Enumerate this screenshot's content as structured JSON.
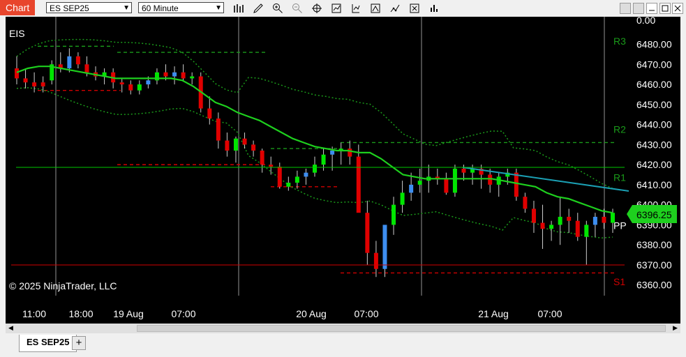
{
  "app": {
    "title": "Chart"
  },
  "toolbar": {
    "instrument": "ES SEP25",
    "interval": "60 Minute",
    "icons": [
      "bar-type-icon",
      "draw-icon",
      "zoom-in-icon",
      "zoom-out-icon",
      "crosshair-icon",
      "indicators-icon",
      "strategies-icon",
      "trade-icon",
      "templates-icon",
      "properties-icon"
    ]
  },
  "chart": {
    "label": "EIS",
    "copyright": "© 2025 NinjaTrader, LLC",
    "price_badge": "6396.25",
    "top_partial": "0.00",
    "colors": {
      "up": "#00e600",
      "down": "#e00000",
      "up_blue": "#3d8ef0",
      "down_red": "#e00000",
      "ma": "#1ed01e",
      "trend": "#1ba0b4"
    }
  },
  "tabs": {
    "active": "ES SEP25",
    "add": "+"
  },
  "chart_data": {
    "type": "candlestick",
    "y_range": [
      6354,
      6484
    ],
    "y_ticks": [
      "6480.00",
      "6470.00",
      "6460.00",
      "6450.00",
      "6440.00",
      "6430.00",
      "6420.00",
      "6410.00",
      "6400.00",
      "6390.00",
      "6380.00",
      "6370.00",
      "6360.00"
    ],
    "x_labels": [
      "11:00",
      "18:00",
      "19 Aug",
      "07:00",
      "20 Aug",
      "07:00",
      "21 Aug",
      "07:00"
    ],
    "pivots": [
      {
        "name": "R3",
        "value": 6482
      },
      {
        "name": "R2",
        "value": 6438
      },
      {
        "name": "R1",
        "value": 6414
      },
      {
        "name": "PP",
        "value": 6390
      },
      {
        "name": "S1",
        "value": 6362
      }
    ],
    "last_price": 6396.25,
    "ma": [
      6466,
      6468,
      6469,
      6469,
      6468,
      6467,
      6466,
      6465,
      6464,
      6463,
      6463,
      6463,
      6463,
      6463,
      6463,
      6462,
      6459,
      6455,
      6451,
      6449,
      6446,
      6444,
      6442,
      6439,
      6436,
      6433,
      6431,
      6429,
      6428,
      6427,
      6427,
      6426,
      6426,
      6423,
      6419,
      6415,
      6414,
      6413,
      6413,
      6413,
      6413,
      6413,
      6413,
      6413,
      6412,
      6411,
      6410,
      6409,
      6406,
      6404,
      6403,
      6401,
      6399,
      6397,
      6396
    ],
    "candles": [
      [
        6468,
        6474,
        6460,
        6463
      ],
      [
        6463,
        6468,
        6458,
        6461
      ],
      [
        6461,
        6466,
        6456,
        6459
      ],
      [
        6461,
        6464,
        6456,
        6459
      ],
      [
        6462,
        6472,
        6460,
        6470
      ],
      [
        6470,
        6476,
        6466,
        6468
      ],
      [
        6468,
        6478,
        6466,
        6474
      ],
      [
        6474,
        6476,
        6468,
        6470
      ],
      [
        6470,
        6474,
        6464,
        6466
      ],
      [
        6466,
        6469,
        6462,
        6464
      ],
      [
        6464,
        6468,
        6460,
        6466
      ],
      [
        6466,
        6468,
        6458,
        6461
      ],
      [
        6461,
        6463,
        6456,
        6460
      ],
      [
        6460,
        6462,
        6455,
        6457
      ],
      [
        6457,
        6462,
        6455,
        6460
      ],
      [
        6460,
        6464,
        6458,
        6462
      ],
      [
        6462,
        6468,
        6460,
        6466
      ],
      [
        6466,
        6470,
        6462,
        6464
      ],
      [
        6464,
        6469,
        6460,
        6466
      ],
      [
        6466,
        6470,
        6462,
        6463
      ],
      [
        6463,
        6466,
        6460,
        6464
      ],
      [
        6464,
        6466,
        6446,
        6448
      ],
      [
        6448,
        6454,
        6440,
        6443
      ],
      [
        6443,
        6446,
        6428,
        6432
      ],
      [
        6432,
        6436,
        6424,
        6427
      ],
      [
        6427,
        6434,
        6421,
        6433
      ],
      [
        6433,
        6436,
        6428,
        6430
      ],
      [
        6430,
        6432,
        6424,
        6427
      ],
      [
        6427,
        6428,
        6416,
        6420
      ],
      [
        6420,
        6424,
        6415,
        6419
      ],
      [
        6419,
        6421,
        6408,
        6409
      ],
      [
        6409,
        6414,
        6407,
        6411
      ],
      [
        6411,
        6417,
        6408,
        6414
      ],
      [
        6414,
        6418,
        6410,
        6416
      ],
      [
        6416,
        6424,
        6414,
        6420
      ],
      [
        6420,
        6428,
        6417,
        6425
      ],
      [
        6425,
        6429,
        6417,
        6427
      ],
      [
        6427,
        6431,
        6420,
        6428
      ],
      [
        6428,
        6432,
        6420,
        6424
      ],
      [
        6424,
        6430,
        6404,
        6396
      ],
      [
        6396,
        6402,
        6370,
        6376
      ],
      [
        6376,
        6382,
        6364,
        6368
      ],
      [
        6368,
        6378,
        6364,
        6390
      ],
      [
        6390,
        6404,
        6385,
        6400
      ],
      [
        6400,
        6412,
        6396,
        6406
      ],
      [
        6406,
        6416,
        6402,
        6410
      ],
      [
        6410,
        6418,
        6406,
        6412
      ],
      [
        6412,
        6420,
        6406,
        6414
      ],
      [
        6414,
        6418,
        6410,
        6413
      ],
      [
        6413,
        6416,
        6405,
        6406
      ],
      [
        6406,
        6420,
        6404,
        6418
      ],
      [
        6418,
        6420,
        6412,
        6416
      ],
      [
        6416,
        6420,
        6410,
        6418
      ],
      [
        6418,
        6420,
        6408,
        6415
      ],
      [
        6415,
        6418,
        6406,
        6410
      ],
      [
        6410,
        6416,
        6404,
        6414
      ],
      [
        6414,
        6418,
        6410,
        6416
      ],
      [
        6416,
        6418,
        6402,
        6404
      ],
      [
        6404,
        6406,
        6396,
        6398
      ],
      [
        6398,
        6402,
        6386,
        6391
      ],
      [
        6391,
        6400,
        6378,
        6388
      ],
      [
        6388,
        6392,
        6382,
        6390
      ],
      [
        6390,
        6404,
        6380,
        6394
      ],
      [
        6394,
        6398,
        6386,
        6392
      ],
      [
        6392,
        6396,
        6382,
        6384
      ],
      [
        6384,
        6392,
        6370,
        6390
      ],
      [
        6390,
        6396,
        6384,
        6394
      ],
      [
        6394,
        6398,
        6388,
        6391
      ],
      [
        6391,
        6398,
        6386,
        6396
      ]
    ]
  }
}
